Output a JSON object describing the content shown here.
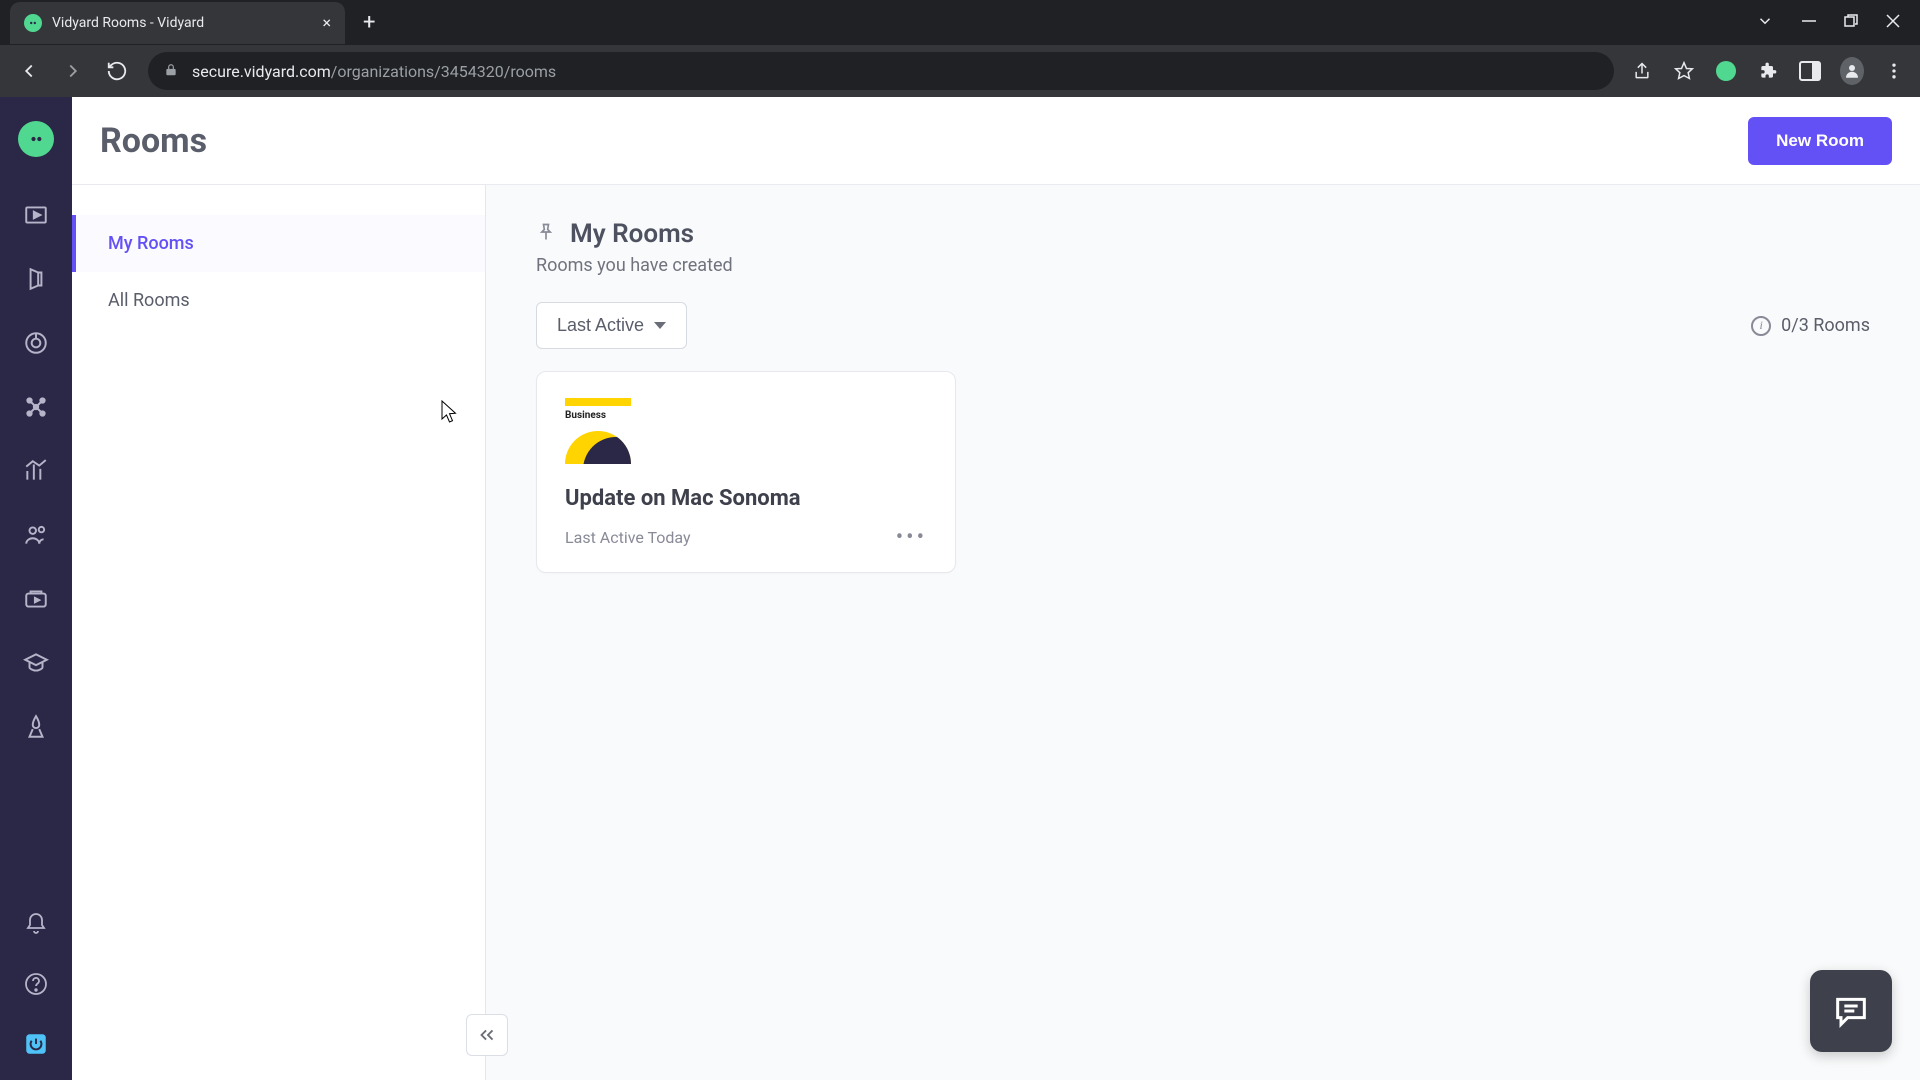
{
  "browser": {
    "tab_title": "Vidyard Rooms - Vidyard",
    "url_host": "secure.vidyard.com",
    "url_path": "/organizations/3454320/rooms"
  },
  "header": {
    "page_title": "Rooms",
    "new_room_label": "New Room"
  },
  "nav": {
    "items": [
      "My Rooms",
      "All Rooms"
    ]
  },
  "main": {
    "title": "My Rooms",
    "subtitle": "Rooms you have created",
    "sort_label": "Last Active",
    "count_label": "0/3 Rooms"
  },
  "cards": [
    {
      "thumb_label": "Business",
      "name": "Update on Mac Sonoma",
      "meta": "Last Active Today"
    }
  ]
}
